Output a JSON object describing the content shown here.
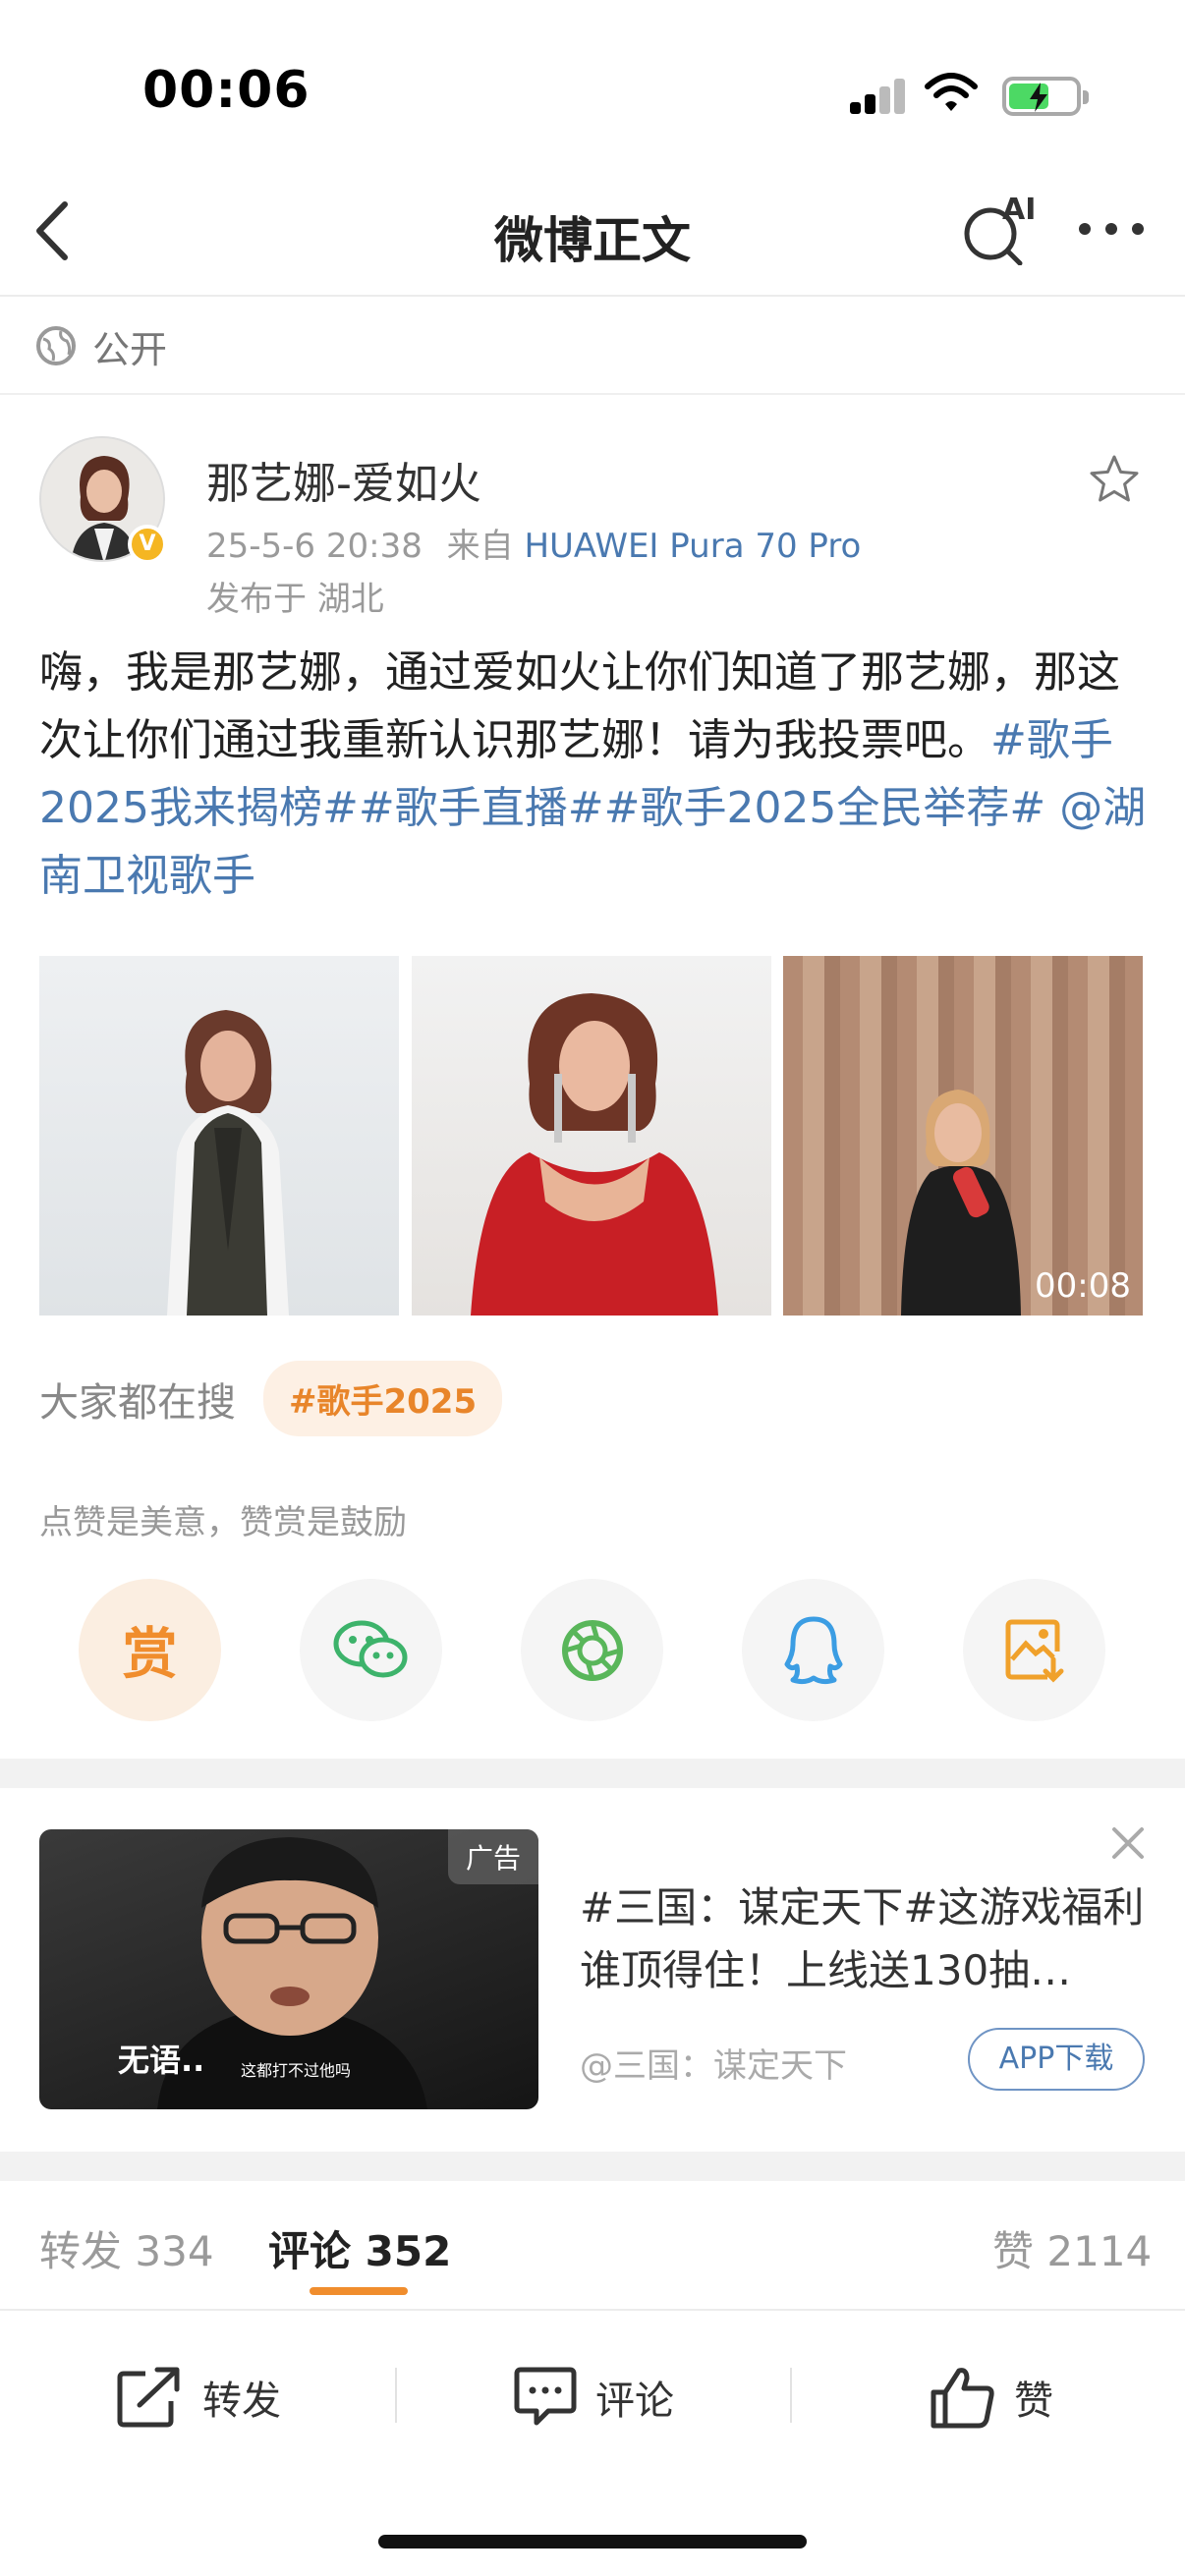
{
  "status_bar": {
    "time": "00:06"
  },
  "nav": {
    "title": "微博正文",
    "ai_label": "AI"
  },
  "visibility": "公开",
  "post": {
    "author": "那艺娜-爱如火",
    "verified_badge": "V",
    "time": "25-5-6 20:38",
    "source_prefix": "来自",
    "device": "HUAWEI Pura 70 Pro",
    "location": "发布于 湖北",
    "text_plain": "嗨，我是那艺娜，通过爱如火让你们知道了那艺娜，那这次让你们通过我重新认识那艺娜！请为我投票吧。",
    "tags": [
      "#歌手2025我来揭榜#",
      "#歌手直播#",
      "#歌手2025全民举荐#",
      " @湖南卫视歌手"
    ],
    "video_duration": "00:08"
  },
  "search": {
    "label": "大家都在搜",
    "chip": "#歌手2025"
  },
  "reward": {
    "hint": "点赞是美意，赞赏是鼓励",
    "reward_label": "赏",
    "share_icons": [
      "reward-icon",
      "wechat-icon",
      "moments-icon",
      "qq-icon",
      "save-image-icon"
    ]
  },
  "ad": {
    "badge": "广告",
    "title": "#三国：谋定天下#这游戏福利谁顶得住！上线送130抽…",
    "source": "@三国：谋定天下",
    "button": "APP下载",
    "caption_main": "无语..",
    "caption_sub": "这都打不过他吗"
  },
  "tabs": {
    "repost_label": "转发",
    "repost_count": "334",
    "comment_label": "评论",
    "comment_count": "352",
    "like_label": "赞",
    "like_count": "2114"
  },
  "bottom_actions": {
    "repost": "转发",
    "comment": "评论",
    "like": "赞"
  },
  "colors": {
    "accent": "#f08d2d",
    "link": "#4a79b0"
  }
}
